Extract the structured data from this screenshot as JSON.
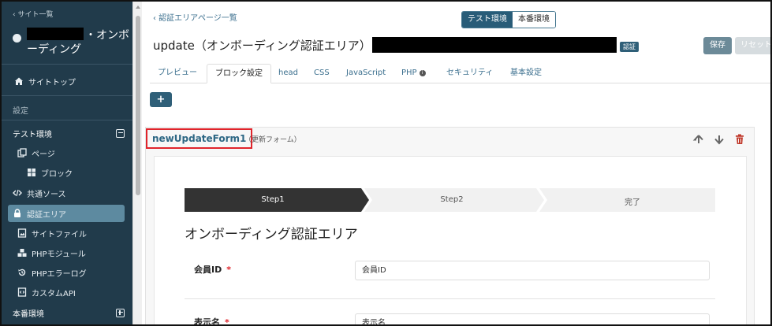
{
  "sidebar": {
    "back_label": "‹ サイト一覧",
    "site_name_suffix": "・オンボ",
    "site_name_line2": "ーディング",
    "site_top": "サイトトップ",
    "settings_heading": "設定",
    "test_env": "テスト環境",
    "items": [
      {
        "label": "ページ"
      },
      {
        "label": "ブロック"
      },
      {
        "label": "共通ソース"
      },
      {
        "label": "認証エリア"
      },
      {
        "label": "サイトファイル"
      },
      {
        "label": "PHPモジュール"
      },
      {
        "label": "PHPエラーログ"
      },
      {
        "label": "カスタムAPI"
      }
    ],
    "prod_env": "本番環境",
    "active_color": "#5d8aa0",
    "bg_color": "#213b4b"
  },
  "header": {
    "breadcrumb": "‹ 認証エリアページ一覧",
    "env_toggle": {
      "test": "テスト環境",
      "prod": "本番環境"
    },
    "title": "update（オンボーディング認証エリア）",
    "badge": "認証",
    "save_label": "保存",
    "reset_label": "リセット"
  },
  "tabs": [
    {
      "label": "プレビュー"
    },
    {
      "label": "ブロック設定"
    },
    {
      "label": "head"
    },
    {
      "label": "CSS"
    },
    {
      "label": "JavaScript"
    },
    {
      "label": "PHP"
    },
    {
      "label": "セキュリティ"
    },
    {
      "label": "基本設定"
    }
  ],
  "add_button_label": "+",
  "block": {
    "name": "newUpdateForm1",
    "subtitle": "（更新フォーム）",
    "highlight_color": "#e0242b"
  },
  "form": {
    "steps": [
      {
        "label": "Step1"
      },
      {
        "label": "Step2"
      },
      {
        "label": "完了"
      }
    ],
    "title": "オンボーディング認証エリア",
    "fields": [
      {
        "label": "会員ID",
        "required_mark": "*",
        "value": "会員ID"
      },
      {
        "label": "表示名",
        "required_mark": "*",
        "value": "表示名"
      }
    ]
  }
}
